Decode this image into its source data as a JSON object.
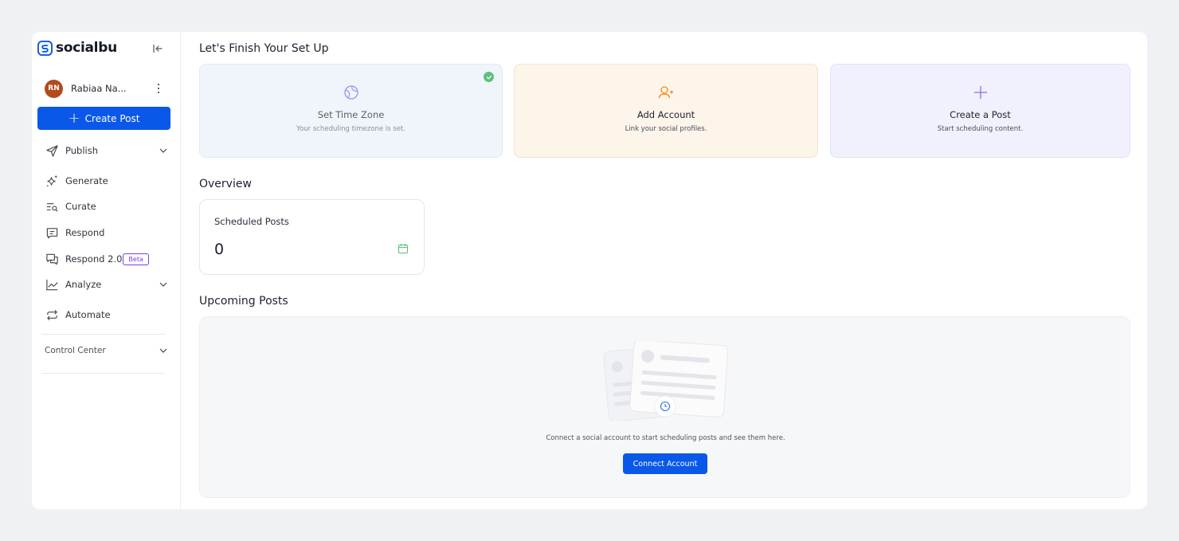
{
  "brand": {
    "name": "socialbu",
    "color": "#0a58ea"
  },
  "user": {
    "initials": "RN",
    "name": "Rabiaa Na..."
  },
  "sidebar": {
    "create_post_label": "Create Post",
    "items": [
      {
        "label": "Publish",
        "icon": "send-icon",
        "expandable": true
      },
      {
        "label": "Generate",
        "icon": "sparkles-icon"
      },
      {
        "label": "Curate",
        "icon": "list-search-icon"
      },
      {
        "label": "Respond",
        "icon": "message-icon"
      },
      {
        "label": "Respond 2.0",
        "icon": "messages-icon",
        "badge": "Beta"
      },
      {
        "label": "Analyze",
        "icon": "chart-line-icon",
        "expandable": true
      },
      {
        "label": "Automate",
        "icon": "repeat-icon"
      }
    ],
    "control_center_label": "Control Center"
  },
  "setup": {
    "title": "Let's Finish Your Set Up",
    "cards": [
      {
        "title": "Set Time Zone",
        "subtitle": "Your scheduling timezone is set.",
        "completed": true,
        "icon": "globe-icon",
        "color": "#9a8ee8"
      },
      {
        "title": "Add Account",
        "subtitle": "Link your social profiles.",
        "icon": "user-plus-icon",
        "color": "#f08a14"
      },
      {
        "title": "Create a Post",
        "subtitle": "Start scheduling content.",
        "icon": "plus-icon",
        "color": "#8a6ee8"
      }
    ]
  },
  "overview": {
    "title": "Overview",
    "scheduled_label": "Scheduled Posts",
    "scheduled_value": "0"
  },
  "upcoming": {
    "title": "Upcoming Posts",
    "empty_text": "Connect a social account to start scheduling posts and see them here.",
    "connect_label": "Connect Account"
  },
  "colors": {
    "success": "#5bc27a",
    "beta": "#7b3fe4"
  }
}
